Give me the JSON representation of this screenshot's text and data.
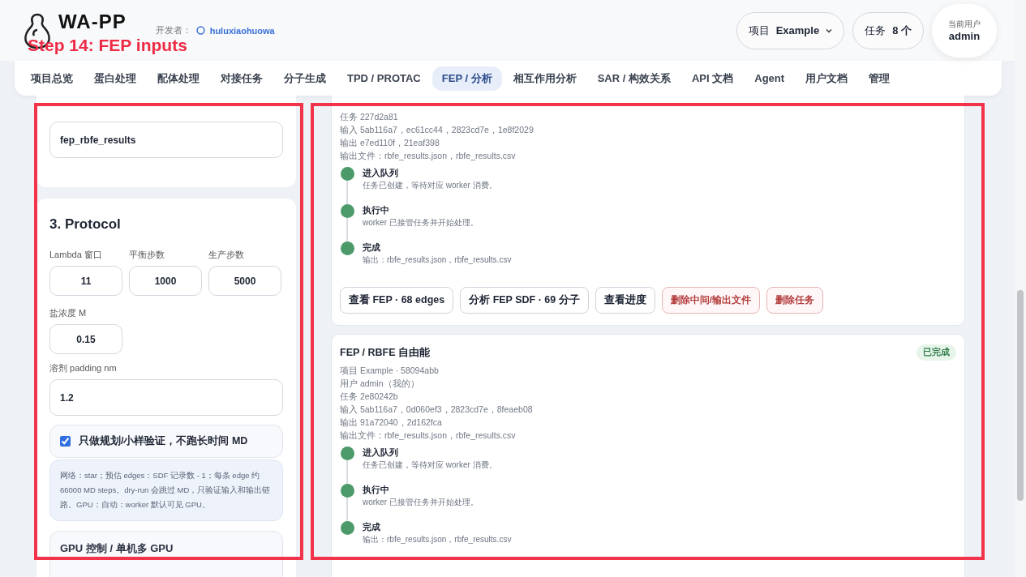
{
  "header": {
    "logo": "WA-PP",
    "developer_label": "开发者：",
    "developer": "huluxiaohuowa",
    "project_label": "项目",
    "project": "Example",
    "tasks_label": "任务",
    "tasks": "8 个",
    "user_label": "当前用户",
    "user": "admin"
  },
  "annotation": {
    "text": "Step 14: FEP inputs"
  },
  "tabs": [
    {
      "label": "项目总览",
      "selected": false
    },
    {
      "label": "蛋白处理",
      "selected": false
    },
    {
      "label": "配体处理",
      "selected": false
    },
    {
      "label": "对接任务",
      "selected": false
    },
    {
      "label": "分子生成",
      "selected": false
    },
    {
      "label": "TPD / PROTAC",
      "selected": false
    },
    {
      "label": "FEP / 分析",
      "selected": true
    },
    {
      "label": "相互作用分析",
      "selected": false
    },
    {
      "label": "SAR / 构效关系",
      "selected": false
    },
    {
      "label": "API 文档",
      "selected": false
    },
    {
      "label": "Agent",
      "selected": false
    },
    {
      "label": "用户文档",
      "selected": false
    },
    {
      "label": "管理",
      "selected": false
    }
  ],
  "output_asset": {
    "value": "fep_rbfe_results"
  },
  "protocol": {
    "title": "3. Protocol",
    "fields": [
      {
        "label": "Lambda 窗口",
        "value": "11"
      },
      {
        "label": "平衡步数",
        "value": "1000"
      },
      {
        "label": "生产步数",
        "value": "5000"
      }
    ],
    "salt": {
      "label": "盐浓度 M",
      "value": "0.15"
    },
    "padding": {
      "label": "溶剂 padding nm",
      "value": "1.2"
    },
    "dry_run": {
      "label": "只做规划/小样验证，不跑长时间 MD",
      "checked": true
    },
    "note": "网络：star；预估 edges：SDF 记录数 - 1；每条 edge 约 66000 MD steps。dry-run 会跳过 MD，只验证输入和输出链路。GPU：自动：worker 默认可见 GPU。",
    "gpu": {
      "title": "GPU 控制 / 单机多 GPU"
    }
  },
  "jobs": [
    {
      "meta": [
        "任务 227d2a81",
        "输入 5ab116a7，ec61cc44，2823cd7e，1e8f2029",
        "输出 e7ed110f，21eaf398",
        "输出文件：rbfe_results.json，rbfe_results.csv"
      ],
      "steps": [
        {
          "title": "进入队列",
          "detail": "任务已创建，等待对应 worker 消费。"
        },
        {
          "title": "执行中",
          "detail": "worker 已接管任务并开始处理。"
        },
        {
          "title": "完成",
          "detail": "输出：rbfe_results.json，rbfe_results.csv"
        }
      ],
      "buttons": [
        {
          "label": "查看 FEP · 68 edges",
          "kind": "default"
        },
        {
          "label": "分析 FEP SDF · 69 分子",
          "kind": "default"
        },
        {
          "label": "查看进度",
          "kind": "default"
        },
        {
          "label": "删除中间/输出文件",
          "kind": "danger"
        },
        {
          "label": "删除任务",
          "kind": "danger"
        }
      ]
    },
    {
      "title": "FEP / RBFE 自由能",
      "status": "已完成",
      "meta": [
        "项目 Example · 58094abb",
        "用户 admin（我的）",
        "任务 2e80242b",
        "输入 5ab116a7，0d060ef3，2823cd7e，8feaeb08",
        "输出 91a72040，2d162fca",
        "输出文件：rbfe_results.json，rbfe_results.csv"
      ],
      "steps": [
        {
          "title": "进入队列",
          "detail": "任务已创建，等待对应 worker 消费。"
        },
        {
          "title": "执行中",
          "detail": "worker 已接管任务并开始处理。"
        },
        {
          "title": "完成",
          "detail": "输出：rbfe_results.json，rbfe_results.csv"
        }
      ]
    }
  ]
}
